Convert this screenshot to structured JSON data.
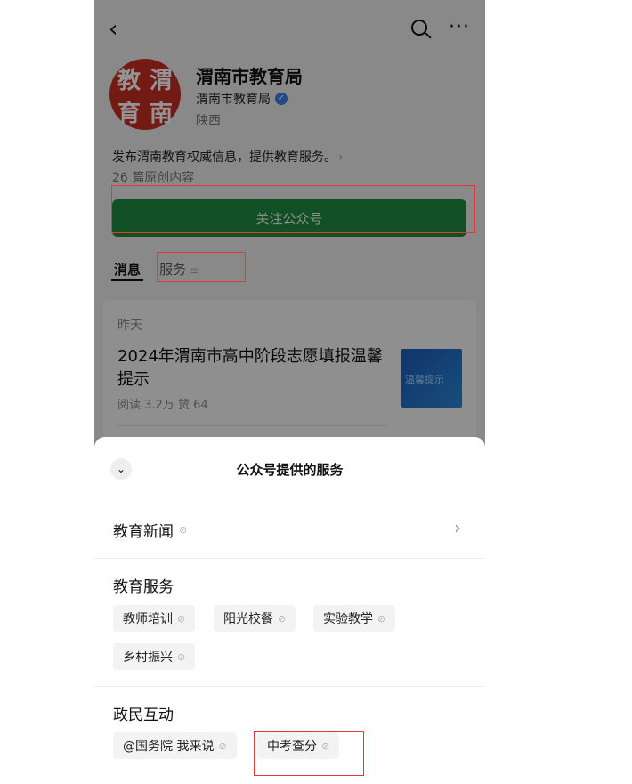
{
  "nav": {
    "back_icon": "‹",
    "more_icon": "···"
  },
  "account": {
    "logo_chars": [
      "教",
      "渭",
      "育",
      "南"
    ],
    "name": "渭南市教育局",
    "verified_name": "渭南市教育局",
    "verified_icon": "✓",
    "region": "陕西",
    "description": "发布渭南教育权威信息，提供教育服务。",
    "description_chevron": "›",
    "article_count": "26 篇原创内容"
  },
  "follow_button": "关注公众号",
  "tabs": {
    "messages": "消息",
    "services": "服务",
    "services_icon": "≡"
  },
  "message": {
    "date": "昨天",
    "title": "2024年渭南市高中阶段志愿填报温馨提示",
    "stats": "阅读 3.2万  赞 64",
    "thumb_text": "温馨提示"
  },
  "sheet": {
    "collapse_icon": "⌄",
    "title": "公众号提供的服务",
    "news": {
      "label": "教育新闻",
      "arrow": "›"
    },
    "link_icon": "⊘",
    "sections": [
      {
        "title": "教育服务",
        "items": [
          "教师培训",
          "阳光校餐",
          "实验教学",
          "乡村振兴"
        ]
      },
      {
        "title": "政民互动",
        "items": [
          "@国务院 我来说",
          "中考查分"
        ]
      }
    ]
  },
  "colors": {
    "follow_green": "#1e8a3e",
    "highlight_red": "#e53935",
    "verified_blue": "#3b7de9",
    "logo_red": "#c62d25"
  }
}
